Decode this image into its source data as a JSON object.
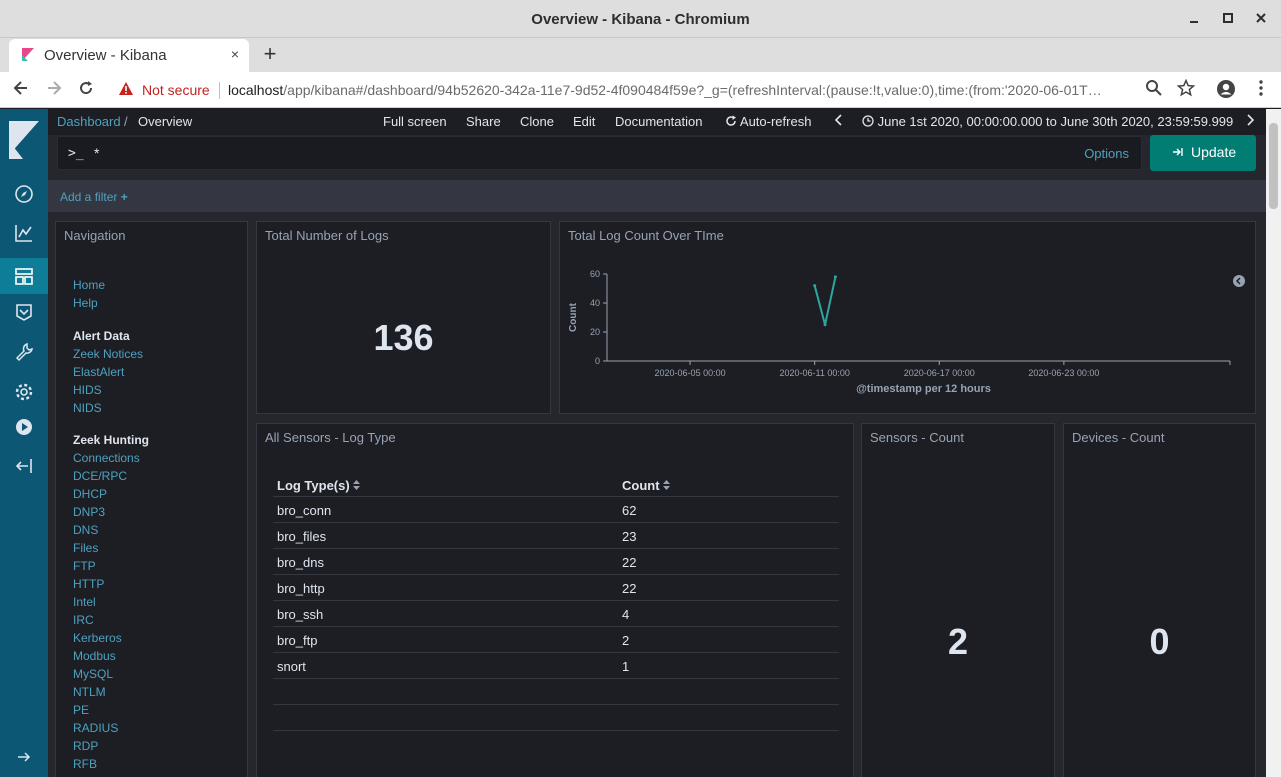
{
  "window": {
    "title": "Overview - Kibana - Chromium",
    "controls": [
      "minimize-icon",
      "maximize-icon",
      "close-icon"
    ]
  },
  "tabs": [
    {
      "title": "Overview - Kibana",
      "close": "×"
    }
  ],
  "new_tab_label": "+",
  "address": {
    "security_text": "Not secure",
    "host": "localhost",
    "path": "/app/kibana#/dashboard/94b52620-342a-11e7-9d52-4f090484f59e?_g=(refreshInterval:(pause:!t,value:0),time:(from:'2020-06-01T…"
  },
  "breadcrumb": {
    "parent": "Dashboard",
    "separator": "/",
    "current": "Overview"
  },
  "top_menu": [
    "Full screen",
    "Share",
    "Clone",
    "Edit",
    "Documentation",
    "Auto-refresh"
  ],
  "time_range": "June 1st 2020, 00:00:00.000 to June 30th 2020, 23:59:59.999",
  "query": {
    "prompt": ">_",
    "value": "*",
    "options_label": "Options",
    "update_label": "Update"
  },
  "filter": {
    "add_label": "Add a filter",
    "add_icon": "+"
  },
  "panels": {
    "navigation": {
      "title": "Navigation",
      "links_top": [
        "Home",
        "Help"
      ],
      "alert_heading": "Alert Data",
      "alert_links": [
        "Zeek Notices",
        "ElastAlert",
        "HIDS",
        "NIDS"
      ],
      "zeek_heading": "Zeek Hunting",
      "zeek_links": [
        "Connections",
        "DCE/RPC",
        "DHCP",
        "DNP3",
        "DNS",
        "Files",
        "FTP",
        "HTTP",
        "Intel",
        "IRC",
        "Kerberos",
        "Modbus",
        "MySQL",
        "NTLM",
        "PE",
        "RADIUS",
        "RDP",
        "RFB"
      ]
    },
    "total_logs": {
      "title": "Total Number of Logs",
      "value": "136"
    },
    "log_count_chart": {
      "title": "Total Log Count Over TIme"
    },
    "sensors_log_type": {
      "title": "All Sensors - Log Type",
      "columns": [
        "Log Type(s)",
        "Count"
      ],
      "rows": [
        [
          "bro_conn",
          "62"
        ],
        [
          "bro_files",
          "23"
        ],
        [
          "bro_dns",
          "22"
        ],
        [
          "bro_http",
          "22"
        ],
        [
          "bro_ssh",
          "4"
        ],
        [
          "bro_ftp",
          "2"
        ],
        [
          "snort",
          "1"
        ]
      ]
    },
    "sensors_count": {
      "title": "Sensors - Count",
      "value": "2"
    },
    "devices_count": {
      "title": "Devices - Count",
      "value": "0"
    }
  },
  "chart_data": {
    "type": "line",
    "title": "",
    "xlabel": "@timestamp per 12 hours",
    "ylabel": "Count",
    "ylim": [
      0,
      60
    ],
    "yticks": [
      "0",
      "20",
      "40",
      "60"
    ],
    "xticks": [
      "2020-06-05 00:00",
      "2020-06-11 00:00",
      "2020-06-17 00:00",
      "2020-06-23 00:00"
    ],
    "xlim": [
      "2020-06-01 00:00",
      "2020-07-01 00:00"
    ],
    "series": [
      {
        "x": [
          "2020-06-11 00:00",
          "2020-06-11 12:00",
          "2020-06-12 00:00"
        ],
        "values": [
          52,
          25,
          58
        ]
      }
    ],
    "line_color": "#2ea6a0",
    "grid": false
  },
  "colors": {
    "accent": "#017d73",
    "link": "#4da1c0",
    "sidenav": "#0b5774"
  }
}
